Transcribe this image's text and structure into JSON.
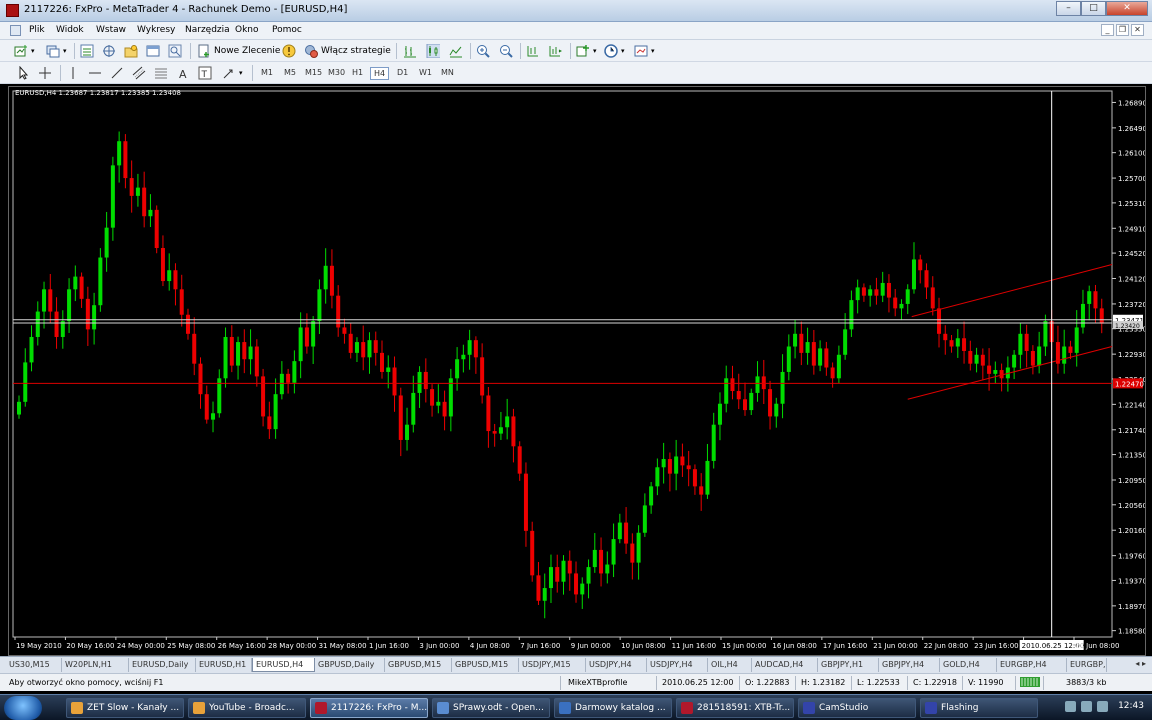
{
  "window": {
    "title": "2117226: FxPro - MetaTrader 4 - Rachunek Demo - [EURUSD,H4]"
  },
  "menu": [
    "Plik",
    "Widok",
    "Wstaw",
    "Wykresy",
    "Narzędzia",
    "Okno",
    "Pomoc"
  ],
  "toolbar": {
    "new_order_label": "Nowe Zlecenie",
    "strategy_label": "Włącz strategie"
  },
  "timeframes": [
    "M1",
    "M5",
    "M15",
    "M30",
    "H1",
    "H4",
    "D1",
    "W1",
    "MN"
  ],
  "active_timeframe": "H4",
  "chart_info": "EURUSD,H4  1.23687 1.23817 1.23385 1.23408",
  "chart_data": {
    "type": "candlestick",
    "symbol": "EURUSD",
    "timeframe": "H4",
    "y_ticks": [
      "1.26890",
      "1.26490",
      "1.26100",
      "1.25700",
      "1.25310",
      "1.24910",
      "1.24520",
      "1.24120",
      "1.23720",
      "1.23330",
      "1.22930",
      "1.22540",
      "1.22140",
      "1.21740",
      "1.21350",
      "1.20950",
      "1.20560",
      "1.20160",
      "1.19760",
      "1.19370",
      "1.18970",
      "1.18580"
    ],
    "ylim": [
      1.1848,
      1.2707
    ],
    "x_ticks": [
      "19 May 2010",
      "20 May 16:00",
      "24 May 00:00",
      "25 May 08:00",
      "26 May 16:00",
      "28 May 00:00",
      "31 May 08:00",
      "1 Jun 16:00",
      "3 Jun 00:00",
      "4 Jun 08:00",
      "7 Jun 16:00",
      "9 Jun 00:00",
      "10 Jun 08:00",
      "11 Jun 16:00",
      "15 Jun 00:00",
      "16 Jun 08:00",
      "17 Jun 16:00",
      "21 Jun 00:00",
      "22 Jun 08:00",
      "23 Jun 16:00",
      "2010.06.25 12:00",
      "28 Jun 08:00"
    ],
    "bid_label": "1.23471",
    "ask_label": "1.23420",
    "red_label": "1.22470",
    "bid_price": 1.23471,
    "ask_price": 1.2342,
    "red_level": 1.2247,
    "crosshair_x_label": "2010.06.25 12:00",
    "closes": [
      1.2218,
      1.228,
      1.232,
      1.236,
      1.2395,
      1.236,
      1.232,
      1.2345,
      1.2395,
      1.2415,
      1.238,
      1.2332,
      1.237,
      1.2445,
      1.2492,
      1.259,
      1.2628,
      1.257,
      1.2542,
      1.2555,
      1.251,
      1.252,
      1.246,
      1.2408,
      1.2425,
      1.2395,
      1.2355,
      1.2325,
      1.2278,
      1.223,
      1.219,
      1.22,
      1.2255,
      1.232,
      1.2275,
      1.2312,
      1.2285,
      1.2305,
      1.2258,
      1.2195,
      1.2175,
      1.223,
      1.2262,
      1.2248,
      1.2282,
      1.2335,
      1.2305,
      1.2345,
      1.2395,
      1.2432,
      1.2385,
      1.2335,
      1.2325,
      1.2295,
      1.2312,
      1.2288,
      1.2315,
      1.2295,
      1.2265,
      1.2272,
      1.2228,
      1.2158,
      1.2182,
      1.2232,
      1.2265,
      1.2238,
      1.2212,
      1.2218,
      1.2195,
      1.2255,
      1.2285,
      1.2292,
      1.2315,
      1.2288,
      1.2228,
      1.2172,
      1.2168,
      1.2178,
      1.2195,
      1.2148,
      1.2105,
      1.2015,
      1.1945,
      1.1905,
      1.1925,
      1.1958,
      1.1935,
      1.1968,
      1.1948,
      1.1915,
      1.1932,
      1.1958,
      1.1985,
      1.1948,
      1.1962,
      1.2002,
      1.2028,
      1.1995,
      1.1965,
      1.2012,
      1.2055,
      1.2085,
      1.2115,
      1.2128,
      1.2105,
      1.2132,
      1.2118,
      1.2112,
      1.2085,
      1.2072,
      1.2125,
      1.2182,
      1.2215,
      1.2255,
      1.2235,
      1.2222,
      1.2205,
      1.2232,
      1.2258,
      1.2238,
      1.2195,
      1.2215,
      1.2265,
      1.2305,
      1.2325,
      1.2295,
      1.2312,
      1.2275,
      1.2302,
      1.2272,
      1.2255,
      1.2292,
      1.2332,
      1.2378,
      1.2398,
      1.2385,
      1.2395,
      1.2385,
      1.2405,
      1.2382,
      1.2365,
      1.2372,
      1.2395,
      1.2442,
      1.2425,
      1.2398,
      1.2365,
      1.2325,
      1.2315,
      1.2305,
      1.2318,
      1.2298,
      1.2278,
      1.2292,
      1.2275,
      1.2262,
      1.2268,
      1.2255,
      1.2272,
      1.2292,
      1.2325,
      1.2298,
      1.2275,
      1.2305,
      1.2345,
      1.2312,
      1.2278,
      1.2305,
      1.2295,
      1.2335,
      1.2372,
      1.2392,
      1.2365,
      1.2341
    ]
  },
  "tabs": [
    "US30,M15",
    "W20PLN,H1",
    "EURUSD,Daily",
    "EURUSD,H1",
    "EURUSD,H4",
    "GBPUSD,Daily",
    "GBPUSD,M15",
    "GBPUSD,M15",
    "USDJPY,M15",
    "USDJPY,H4",
    "USDJPY,H4",
    "OIL,H4",
    "AUDCAD,H4",
    "GBPJPY,H1",
    "GBPJPY,H4",
    "GOLD,H4",
    "EURGBP,H4",
    "EURGBP,"
  ],
  "active_tab": "EURUSD,H4",
  "status": {
    "help": "Aby otworzyć okno pomocy, wciśnij F1",
    "profile": "MikeXTBprofile",
    "datetime": "2010.06.25 12:00",
    "open": "O: 1.22883",
    "high": "H: 1.23182",
    "low": "L: 1.22533",
    "close": "C: 1.22918",
    "volume": "V: 11990",
    "traffic": "3883/3 kb"
  },
  "taskbar": {
    "items": [
      {
        "label": "ZET Slow - Kanały ...",
        "color": "#e8a23a"
      },
      {
        "label": "YouTube - Broadc...",
        "color": "#e8a23a"
      },
      {
        "label": "2117226: FxPro - M...",
        "color": "#b0182b"
      },
      {
        "label": "SPrawy.odt - Open...",
        "color": "#5a8cd0"
      },
      {
        "label": "Darmowy katalog ...",
        "color": "#3a70c0"
      },
      {
        "label": "281518591: XTB-Tr...",
        "color": "#b0182b"
      },
      {
        "label": "CamStudio",
        "color": "#3344aa"
      },
      {
        "label": "Flashing",
        "color": "#3344aa"
      }
    ],
    "clock": "12:43"
  }
}
